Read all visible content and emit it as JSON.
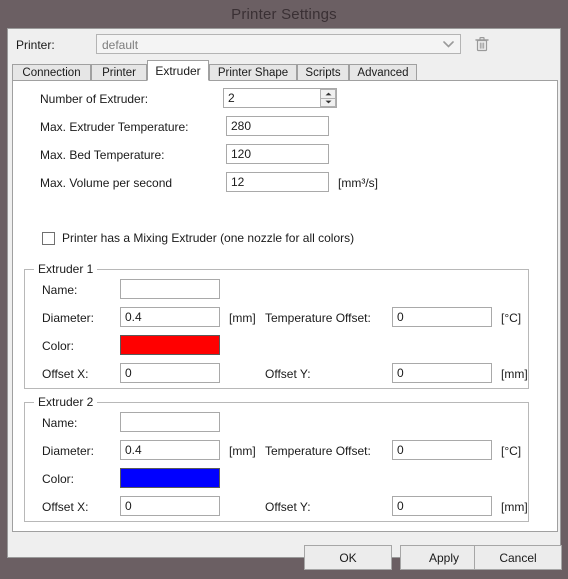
{
  "window": {
    "title": "Printer Settings",
    "frame_color": "#6b5f63",
    "dialog_bg": "#efefef"
  },
  "printer_selector": {
    "label": "Printer:",
    "value": "default",
    "placeholder": "default",
    "dropdown_icon": "chevron-down-icon",
    "delete_icon": "trash-icon"
  },
  "tabs": [
    {
      "label": "Connection",
      "active": false
    },
    {
      "label": "Printer",
      "active": false
    },
    {
      "label": "Extruder",
      "active": true
    },
    {
      "label": "Printer Shape",
      "active": false
    },
    {
      "label": "Scripts",
      "active": false
    },
    {
      "label": "Advanced",
      "active": false
    }
  ],
  "extruder_tab": {
    "fields": [
      {
        "label": "Number of Extruder:",
        "value": "2",
        "unit": "",
        "spinner": true
      },
      {
        "label": "Max. Extruder Temperature:",
        "value": "280",
        "unit": "",
        "spinner": false
      },
      {
        "label": "Max. Bed Temperature:",
        "value": "120",
        "unit": "",
        "spinner": false
      },
      {
        "label": "Max. Volume per second",
        "value": "12",
        "unit": "[mm³/s]",
        "spinner": false
      }
    ],
    "mixing_extruder": {
      "label": "Printer has a Mixing Extruder (one nozzle for all colors)",
      "checked": false
    },
    "extruders": [
      {
        "title": "Extruder 1",
        "name_label": "Name:",
        "name_value": "",
        "diameter_label": "Diameter:",
        "diameter_value": "0.4",
        "diameter_unit": "[mm]",
        "temp_offset_label": "Temperature Offset:",
        "temp_offset_value": "0",
        "temp_offset_unit": "[°C]",
        "color_label": "Color:",
        "color_value": "#ff0000",
        "offset_x_label": "Offset X:",
        "offset_x_value": "0",
        "offset_y_label": "Offset Y:",
        "offset_y_value": "0",
        "offset_unit": "[mm]"
      },
      {
        "title": "Extruder 2",
        "name_label": "Name:",
        "name_value": "",
        "diameter_label": "Diameter:",
        "diameter_value": "0.4",
        "diameter_unit": "[mm]",
        "temp_offset_label": "Temperature Offset:",
        "temp_offset_value": "0",
        "temp_offset_unit": "[°C]",
        "color_label": "Color:",
        "color_value": "#0000ff",
        "offset_x_label": "Offset X:",
        "offset_x_value": "0",
        "offset_y_label": "Offset Y:",
        "offset_y_value": "0",
        "offset_unit": "[mm]"
      }
    ]
  },
  "buttons": {
    "ok": "OK",
    "apply": "Apply",
    "cancel": "Cancel"
  }
}
